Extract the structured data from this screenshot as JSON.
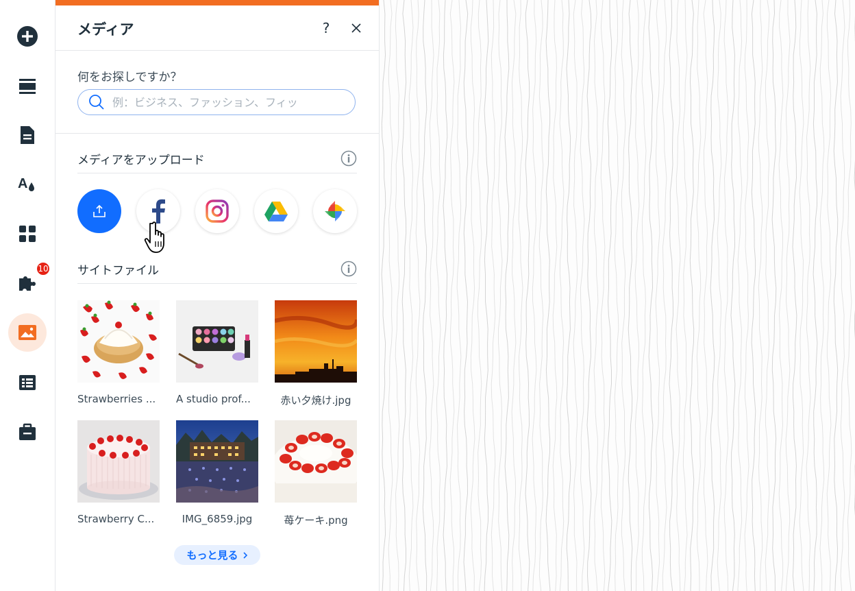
{
  "rail": {
    "badge_count": "10",
    "items": [
      {
        "name": "add-elements",
        "icon": "plus-circle-icon"
      },
      {
        "name": "sections",
        "icon": "sections-icon"
      },
      {
        "name": "pages",
        "icon": "page-icon"
      },
      {
        "name": "design",
        "icon": "theme-icon"
      },
      {
        "name": "apps",
        "icon": "apps-icon"
      },
      {
        "name": "business-tools",
        "icon": "puzzle-icon"
      },
      {
        "name": "media",
        "icon": "image-icon"
      },
      {
        "name": "cms",
        "icon": "table-icon"
      },
      {
        "name": "portfolio",
        "icon": "briefcase-icon"
      }
    ]
  },
  "panel": {
    "title": "メディア",
    "help_label": "?",
    "search": {
      "label": "何をお探しですか？",
      "placeholder": "例：ビジネス、ファッション、フィッ"
    },
    "upload_section": {
      "title": "メディアをアップロード",
      "sources": [
        "upload",
        "facebook",
        "instagram",
        "google-drive",
        "google-photos"
      ]
    },
    "site_files": {
      "title": "サイトファイル",
      "files": [
        {
          "label": "Strawberries ..."
        },
        {
          "label": "A studio prof..."
        },
        {
          "label": "赤い夕焼け.jpg"
        },
        {
          "label": "Strawberry C..."
        },
        {
          "label": "IMG_6859.jpg"
        },
        {
          "label": "苺ケーキ.png"
        }
      ]
    },
    "more_button": "もっと見る"
  },
  "colors": {
    "accent": "#f26d21",
    "primary": "#116dff",
    "text": "#20303c"
  }
}
